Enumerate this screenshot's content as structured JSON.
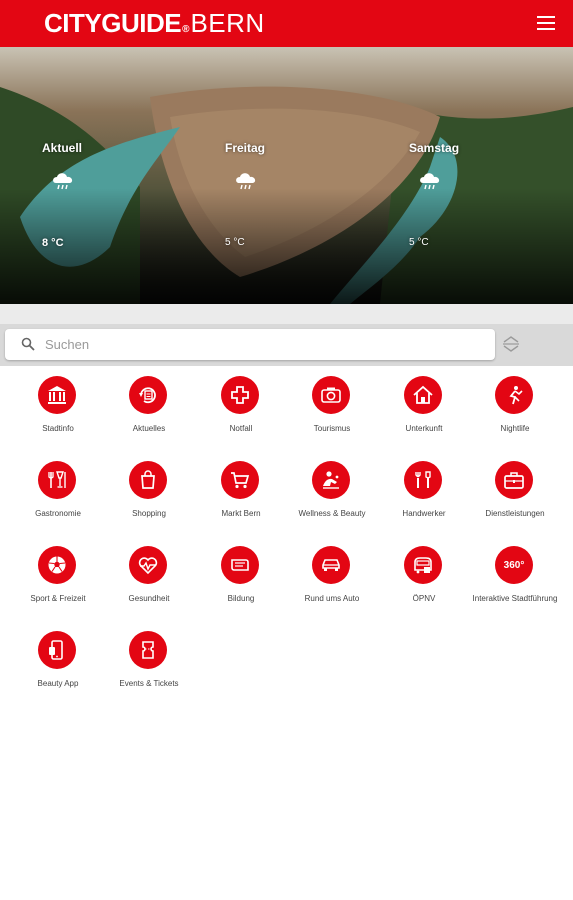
{
  "header": {
    "logo_city": "CITYGUIDE",
    "logo_sep": "®",
    "logo_bern": "BERN",
    "menu_icon": "hamburger-menu-icon",
    "brand_color": "#e30613"
  },
  "weather": [
    {
      "day": "Aktuell",
      "temp": "8 °C",
      "icon": "cloud-rain-icon"
    },
    {
      "day": "Freitag",
      "temp": "5 °C",
      "icon": "cloud-rain-icon"
    },
    {
      "day": "Samstag",
      "temp": "5 °C",
      "icon": "cloud-rain-icon"
    }
  ],
  "search": {
    "placeholder": "Suchen",
    "value": "",
    "sort_icon": "sort-arrows-icon"
  },
  "categories": [
    {
      "label": "Stadtinfo",
      "icon": "building-columns-icon"
    },
    {
      "label": "Aktuelles",
      "icon": "newspaper-refresh-icon"
    },
    {
      "label": "Notfall",
      "icon": "medical-cross-icon"
    },
    {
      "label": "Tourismus",
      "icon": "camera-icon"
    },
    {
      "label": "Unterkunft",
      "icon": "house-icon"
    },
    {
      "label": "Nightlife",
      "icon": "dancer-icon"
    },
    {
      "label": "Gastronomie",
      "icon": "fork-knife-glass-icon"
    },
    {
      "label": "Shopping",
      "icon": "shopping-bag-icon"
    },
    {
      "label": "Markt Bern",
      "icon": "shopping-cart-icon"
    },
    {
      "label": "Wellness & Beauty",
      "icon": "spa-person-icon"
    },
    {
      "label": "Handwerker",
      "icon": "tools-icon"
    },
    {
      "label": "Dienstleistungen",
      "icon": "briefcase-icon"
    },
    {
      "label": "Sport & Freizeit",
      "icon": "soccer-ball-icon"
    },
    {
      "label": "Gesundheit",
      "icon": "heart-pulse-icon"
    },
    {
      "label": "Bildung",
      "icon": "education-icon"
    },
    {
      "label": "Rund ums Auto",
      "icon": "car-icon"
    },
    {
      "label": "ÖPNV",
      "icon": "tram-icon"
    },
    {
      "label": "Interaktive Stadtführung",
      "icon": "360-icon",
      "badge": "360°"
    },
    {
      "label": "Beauty App",
      "icon": "phone-app-icon"
    },
    {
      "label": "Events & Tickets",
      "icon": "ticket-icon"
    }
  ]
}
